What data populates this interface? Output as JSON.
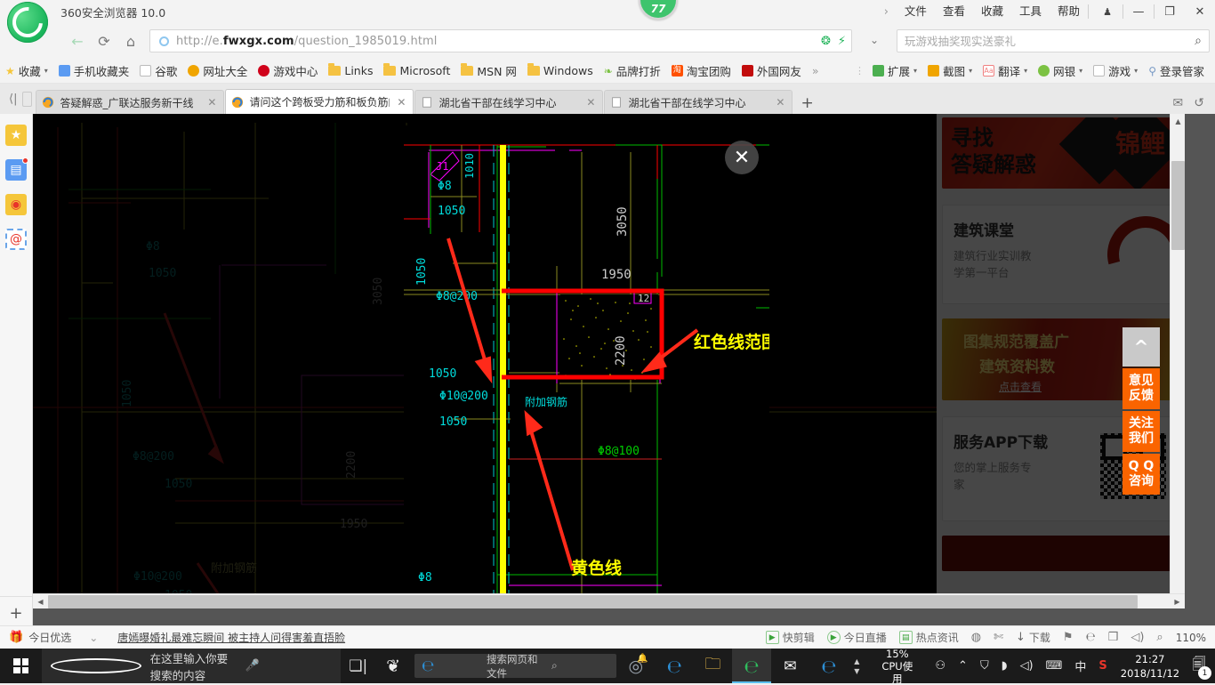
{
  "window": {
    "app_title": "360安全浏览器 10.0",
    "score_badge": "77",
    "menus": [
      "文件",
      "查看",
      "收藏",
      "工具",
      "帮助"
    ],
    "chevron": "›",
    "controls": {
      "skin": "skin-icon",
      "minimize": "—",
      "maximize": "❐",
      "close": "✕"
    }
  },
  "nav": {
    "back_icon": "←",
    "reload_icon": "⟳",
    "home_icon": "⌂",
    "url": {
      "scheme": "http://e.",
      "domain": "fwxgx.com",
      "path": "/question_1985019.html"
    },
    "url_full": "http://e.fwxgx.com/question_1985019.html",
    "ssl_icon": "circle-icon",
    "addr_icons": [
      "refresh-circle-icon",
      "lightning-icon"
    ],
    "search": {
      "placeholder": "玩游戏抽奖现实送豪礼",
      "value": "",
      "chevron": "⌄",
      "magnifier": "🔍"
    }
  },
  "bookmarks": {
    "items": [
      {
        "label": "收藏",
        "icon": "star-folder-icon",
        "caret": "▾"
      },
      {
        "label": "手机收藏夹",
        "icon": "phone-icon"
      },
      {
        "label": "谷歌",
        "icon": "page-icon"
      },
      {
        "label": "网址大全",
        "icon": "plus-circle-icon"
      },
      {
        "label": "游戏中心",
        "icon": "game-circle-icon"
      },
      {
        "label": "Links",
        "icon": "folder-icon"
      },
      {
        "label": "Microsoft",
        "icon": "folder-icon"
      },
      {
        "label": "MSN 网",
        "icon": "folder-icon"
      },
      {
        "label": "Windows",
        "icon": "folder-icon"
      },
      {
        "label": "品牌打折",
        "icon": "leaf-icon"
      },
      {
        "label": "淘宝团购",
        "icon": "taobao-icon"
      },
      {
        "label": "外国网友",
        "icon": "flag-icon"
      },
      {
        "label": "»",
        "icon": "overflow-icon"
      }
    ],
    "right_items": [
      {
        "label": "扩展",
        "icon": "extension-icon",
        "caret": "▾"
      },
      {
        "label": "截图",
        "icon": "screenshot-icon",
        "caret": "▾"
      },
      {
        "label": "翻译",
        "icon": "translate-icon",
        "caret": "▾"
      },
      {
        "label": "网银",
        "icon": "shield-bank-icon",
        "caret": "▾"
      },
      {
        "label": "游戏",
        "icon": "gamepad-icon",
        "caret": "▾"
      },
      {
        "label": "登录管家",
        "icon": "key-icon"
      }
    ]
  },
  "tabs": {
    "nav_left_icon": "⟨|",
    "list_icon": "list-icon",
    "items": [
      {
        "title": "答疑解惑_广联达服务新干线",
        "active": false,
        "favicon": "360-icon"
      },
      {
        "title": "请问这个跨板受力筋和板负筋的补",
        "active": true,
        "favicon": "360-icon"
      },
      {
        "title": "湖北省干部在线学习中心",
        "active": false,
        "favicon": "page-icon"
      },
      {
        "title": "湖北省干部在线学习中心",
        "active": false,
        "favicon": "page-icon"
      }
    ],
    "new_tab": "+",
    "right_icons": [
      "mail-icon",
      "undo-icon"
    ]
  },
  "rail": {
    "items": [
      {
        "name": "favorites-icon",
        "glyph": "★",
        "bg": "#f5c63a",
        "badge": false
      },
      {
        "name": "news-icon",
        "glyph": "▤",
        "bg": "#5b9bf2",
        "badge": true
      },
      {
        "name": "weibo-icon",
        "glyph": "◉",
        "bg": "#f26a4f",
        "badge": false
      },
      {
        "name": "mail-at-icon",
        "glyph": "@",
        "bg": "#ffffff",
        "badge": false
      }
    ],
    "add": "+"
  },
  "lightbox": {
    "close_label": "✕",
    "annotations": [
      {
        "text": "红色线范围",
        "color": "#ffff00"
      },
      {
        "text": "黄色线",
        "color": "#ffff00"
      }
    ],
    "cad_labels": {
      "dim_3050": "3050",
      "dim_2200": "2200",
      "dim_1950": "1950",
      "dim_1050": "1050",
      "dim_1010": "1010",
      "rebar_phi8_200": "Φ8@200",
      "rebar_phi10_200": "Φ10@200",
      "rebar_phi8_100": "Φ8@100",
      "rebar_phi8": "Φ8",
      "extra_rebar": "附加钢筋",
      "j1": "J1",
      "slab_12": "12"
    }
  },
  "sidebar": {
    "banner1": {
      "line1": "寻找",
      "line2": "答疑解惑",
      "badge": "锦鲤"
    },
    "card1": {
      "title": "建筑课堂",
      "desc1": "建筑行业实训教",
      "desc2": "学第一平台"
    },
    "banner2": {
      "line1": "图集规范覆盖广",
      "line2": "建筑资料数",
      "link": "点击查看"
    },
    "card2": {
      "title": "服务APP下载",
      "desc1": "您的掌上服务专",
      "desc2": "家"
    }
  },
  "float_buttons": [
    {
      "name": "back-to-top-button",
      "line1": "^",
      "line2": "",
      "style": "gray"
    },
    {
      "name": "feedback-button",
      "line1": "意见",
      "line2": "反馈",
      "style": "orange"
    },
    {
      "name": "follow-us-button",
      "line1": "关注",
      "line2": "我们",
      "style": "orange"
    },
    {
      "name": "qq-consult-button",
      "line1": "Q Q",
      "line2": "咨询",
      "style": "orange"
    }
  ],
  "statusbar": {
    "today_picks": "今日优选",
    "news_chevron": "⌄",
    "news": "唐嫣曝婚礼最难忘瞬间 被主持人问得害羞直捂脸",
    "right_items": [
      {
        "label": "快剪辑",
        "icon": "video-edit-icon"
      },
      {
        "label": "今日直播",
        "icon": "live-icon"
      },
      {
        "label": "热点资讯",
        "icon": "hot-news-icon"
      },
      {
        "label": "",
        "icon": "shield-icon"
      },
      {
        "label": "",
        "icon": "rocket-icon"
      },
      {
        "label": "下载",
        "icon": "download-icon"
      },
      {
        "label": "",
        "icon": "flag-icon"
      },
      {
        "label": "",
        "icon": "theme-icon"
      },
      {
        "label": "",
        "icon": "window-icon"
      },
      {
        "label": "",
        "icon": "volume-icon"
      },
      {
        "label": "",
        "icon": "zoom-icon"
      },
      {
        "label": "110%",
        "icon": "zoom-level"
      }
    ]
  },
  "taskbar": {
    "start_icon": "windows-icon",
    "search_placeholder": "在这里输入你要搜索的内容",
    "cortana_icon": "circle-icon",
    "mic_icon": "mic-icon",
    "taskview_icon": "task-view-icon",
    "apps": [
      {
        "name": "taskbar-app-sogou",
        "icon": "sogou-icon"
      }
    ],
    "edge_pill": {
      "placeholder": "搜索网页和文件",
      "magnifier": "🔍"
    },
    "pinned": [
      {
        "name": "taskbar-app-360se",
        "icon": "360-circle-icon"
      },
      {
        "name": "taskbar-app-ie",
        "icon": "ie-icon"
      },
      {
        "name": "taskbar-app-explorer",
        "icon": "folder-icon"
      },
      {
        "name": "taskbar-app-360browser",
        "icon": "360-green-icon"
      },
      {
        "name": "taskbar-app-mail",
        "icon": "mail-icon"
      },
      {
        "name": "taskbar-app-edge",
        "icon": "edge-icon"
      }
    ],
    "cpu": {
      "value": "15%",
      "label": "CPU使用"
    },
    "tray": [
      {
        "name": "tray-people-icon",
        "glyph": "⚇"
      },
      {
        "name": "tray-chevron-up-icon",
        "glyph": "⌃"
      },
      {
        "name": "tray-safe-icon",
        "glyph": "⛨"
      },
      {
        "name": "tray-wifi-icon",
        "glyph": "◗"
      },
      {
        "name": "tray-volume-icon",
        "glyph": "🔊"
      },
      {
        "name": "tray-keyboard-icon",
        "glyph": "⌨"
      },
      {
        "name": "tray-ime-icon",
        "glyph": "中"
      },
      {
        "name": "tray-sogou-icon",
        "glyph": "S"
      }
    ],
    "clock": {
      "time": "21:27",
      "date": "2018/11/12"
    },
    "notification_count": "1"
  }
}
